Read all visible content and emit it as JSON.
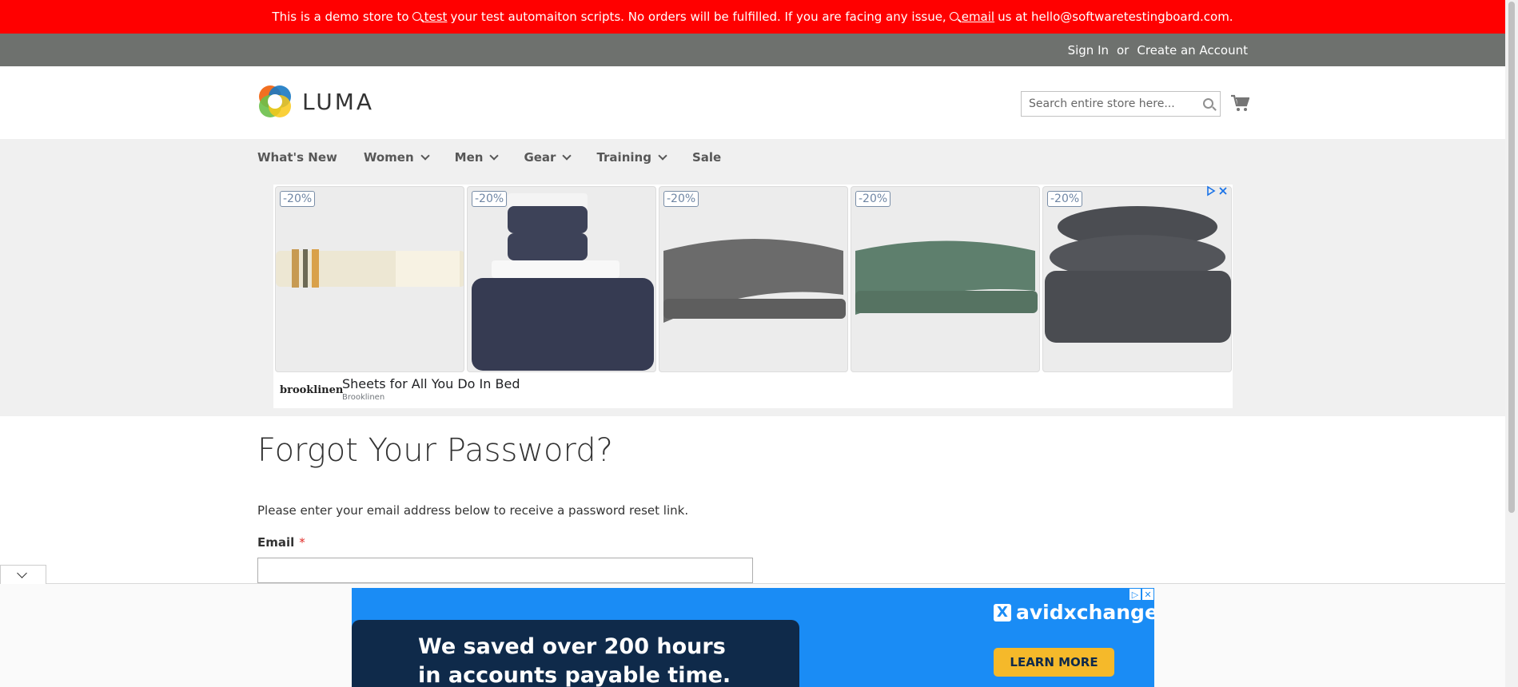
{
  "demo_banner": {
    "text_1": "This is a demo store to",
    "link_1": "test",
    "text_2": "your test automaiton scripts. No orders will be fulfilled. If you are facing any issue,",
    "link_2": "email",
    "text_3": "us at hello@softwaretestingboard.com."
  },
  "header": {
    "sign_in": "Sign In",
    "or": "or",
    "create_account": "Create an Account",
    "logo_text": "LUMA",
    "search_placeholder": "Search entire store here...",
    "cart_icon": "cart-icon"
  },
  "nav": {
    "items": [
      {
        "label": "What's New",
        "dropdown": false
      },
      {
        "label": "Women",
        "dropdown": true
      },
      {
        "label": "Men",
        "dropdown": true
      },
      {
        "label": "Gear",
        "dropdown": true
      },
      {
        "label": "Training",
        "dropdown": true
      },
      {
        "label": "Sale",
        "dropdown": false
      }
    ]
  },
  "ad": {
    "badges": [
      "-20%",
      "-20%",
      "-20%",
      "-20%",
      "-20%"
    ],
    "brand": "brooklinen",
    "title": "Sheets for All You Do In Bed",
    "advertiser": "Brooklinen"
  },
  "main": {
    "page_title": "Forgot Your Password?",
    "intro": "Please enter your email address below to receive a password reset link.",
    "email_label": "Email",
    "required_mark": "*",
    "email_value": ""
  },
  "bottom_ad": {
    "headline_1": "We saved over 200 hours",
    "headline_2": "in accounts payable time.",
    "brand": "avidxchange",
    "brand_mark": "X",
    "cta": "LEARN MORE"
  },
  "colors": {
    "banner": "#ff0000",
    "header_bar": "#6e716e",
    "nav_bg": "#f0f0f0",
    "ad_blue": "#1a8cf5",
    "cta_yellow": "#f5b92a"
  }
}
